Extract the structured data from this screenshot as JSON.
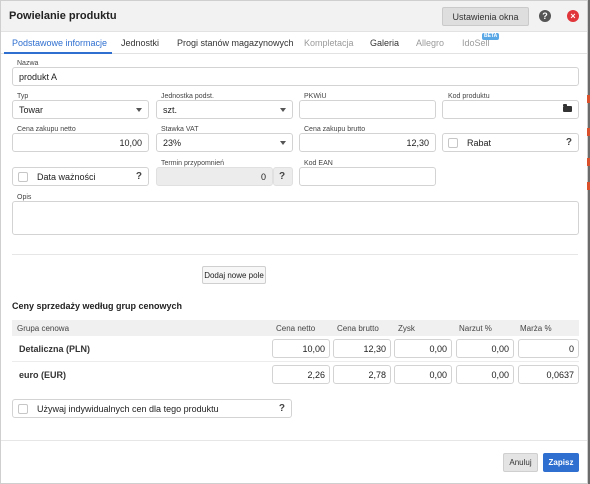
{
  "window": {
    "title": "Powielanie produktu",
    "settings_label": "Ustawienia okna",
    "help_glyph": "?",
    "close_glyph": "×"
  },
  "tabs": [
    {
      "label": "Podstawowe informacje",
      "state": "active"
    },
    {
      "label": "Jednostki",
      "state": "normal"
    },
    {
      "label": "Progi stanów magazynowych",
      "state": "normal"
    },
    {
      "label": "Kompletacja",
      "state": "disabled"
    },
    {
      "label": "Galeria",
      "state": "normal"
    },
    {
      "label": "Allegro",
      "state": "disabled"
    },
    {
      "label": "IdoSell",
      "state": "disabled",
      "badge": "BETA"
    }
  ],
  "form": {
    "name": {
      "label": "Nazwa",
      "value": "produkt A"
    },
    "type": {
      "label": "Typ",
      "value": "Towar"
    },
    "base_unit": {
      "label": "Jednostka podst.",
      "value": "szt."
    },
    "pkwiu": {
      "label": "PKWiU",
      "value": ""
    },
    "product_code": {
      "label": "Kod produktu",
      "value": ""
    },
    "purchase_net": {
      "label": "Cena zakupu netto",
      "value": "10,00"
    },
    "vat_rate": {
      "label": "Stawka VAT",
      "value": "23%"
    },
    "purchase_gross": {
      "label": "Cena zakupu brutto",
      "value": "12,30"
    },
    "discount": {
      "label": "Rabat",
      "help": "?"
    },
    "expiry_date": {
      "label": "Data ważności",
      "help": "?"
    },
    "reminder_term": {
      "label": "Termin przypomnień",
      "value": "0",
      "help": "?"
    },
    "ean": {
      "label": "Kod EAN",
      "value": ""
    },
    "description": {
      "label": "Opis",
      "value": ""
    },
    "add_field_label": "Dodaj nowe pole"
  },
  "prices": {
    "section_title": "Ceny sprzedaży według grup cenowych",
    "columns": [
      "Grupa cenowa",
      "Cena netto",
      "Cena brutto",
      "Zysk",
      "Narzut %",
      "Marża %"
    ],
    "rows": [
      {
        "group": "Detaliczna (PLN)",
        "values": [
          "10,00",
          "12,30",
          "0,00",
          "0,00",
          "0"
        ]
      },
      {
        "group": "euro (EUR)",
        "values": [
          "2,26",
          "2,78",
          "0,00",
          "0,00",
          "0,0637"
        ]
      }
    ],
    "individual_label": "Używaj indywidualnych cen dla tego produktu",
    "individual_help": "?"
  },
  "footer": {
    "cancel_label": "Anuluj",
    "save_label": "Zapisz"
  },
  "colors": {
    "accent": "#2f6fd0",
    "close": "#e0353a"
  }
}
